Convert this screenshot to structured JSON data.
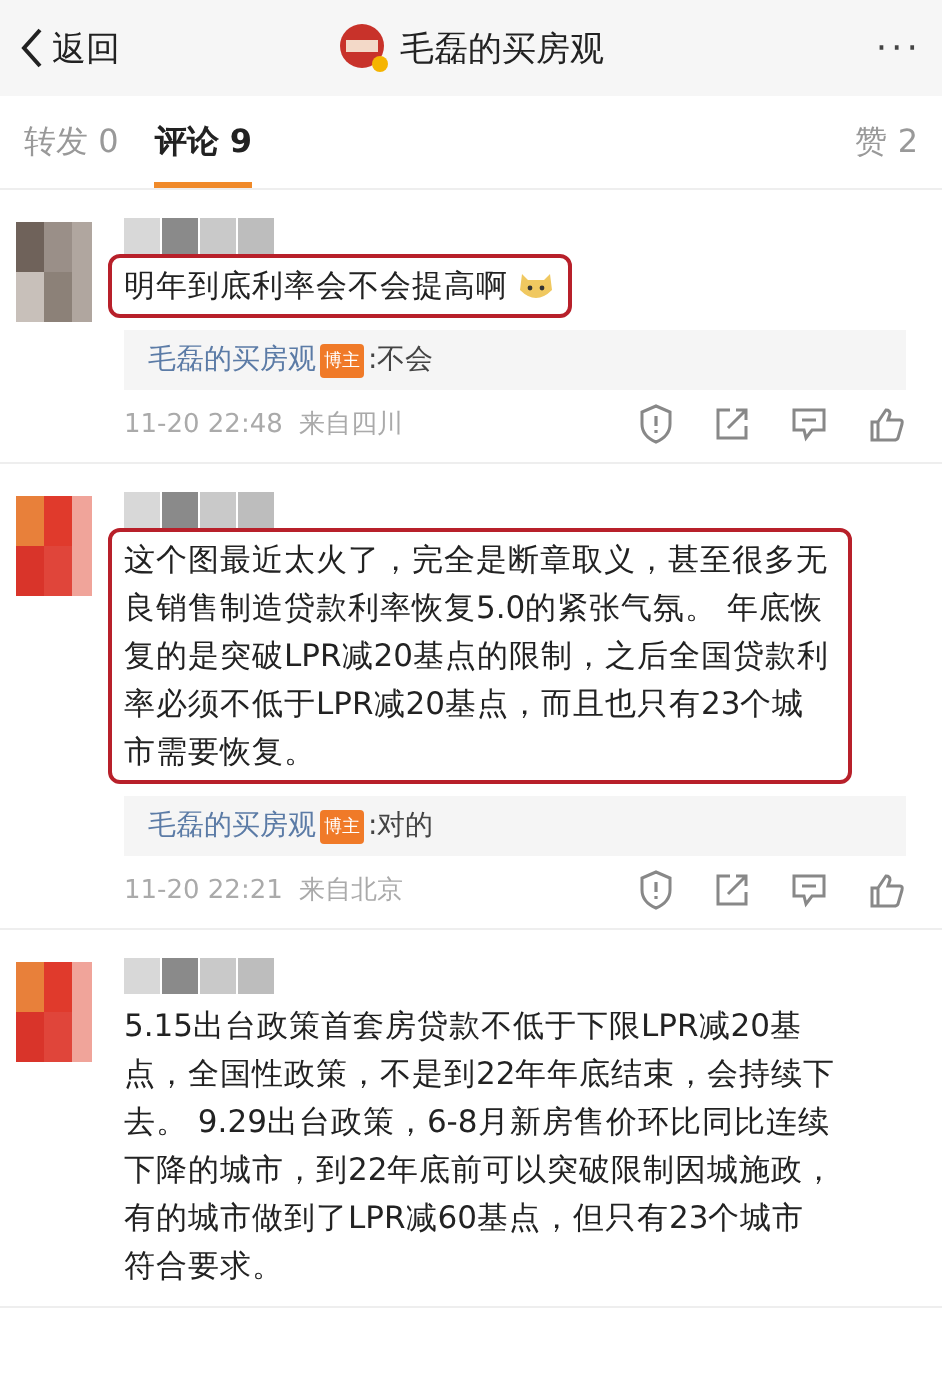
{
  "header": {
    "back_label": "返回",
    "title": "毛磊的买房观",
    "more": "···"
  },
  "tabs": [
    {
      "label": "转发 0",
      "selected": false
    },
    {
      "label": "评论 9",
      "selected": true
    },
    {
      "label": "赞 2",
      "selected": false
    }
  ],
  "comments": [
    {
      "text": "明年到底利率会不会提高啊",
      "emoji": true,
      "highlighted": true,
      "reply": {
        "author": "毛磊的买房观",
        "badge": "博主",
        "text": ":不会"
      },
      "time": "11-20 22:48",
      "location": "来自四川"
    },
    {
      "text": "这个图最近太火了，完全是断章取义，甚至很多无良销售制造贷款利率恢复5.0的紧张气氛。 年底恢复的是突破LPR减20基点的限制，之后全国贷款利率必须不低于LPR减20基点，而且也只有23个城市需要恢复。",
      "emoji": false,
      "highlighted": true,
      "reply": {
        "author": "毛磊的买房观",
        "badge": "博主",
        "text": ":对的"
      },
      "time": "11-20 22:21",
      "location": "来自北京"
    },
    {
      "text": "5.15出台政策首套房贷款不低于下限LPR减20基点，全国性政策，不是到22年年底结束，会持续下去。 9.29出台政策，6-8月新房售价环比同比连续下降的城市，到22年底前可以突破限制因城施政，有的城市做到了LPR减60基点，但只有23个城市符合要求。",
      "emoji": false,
      "highlighted": false
    }
  ]
}
